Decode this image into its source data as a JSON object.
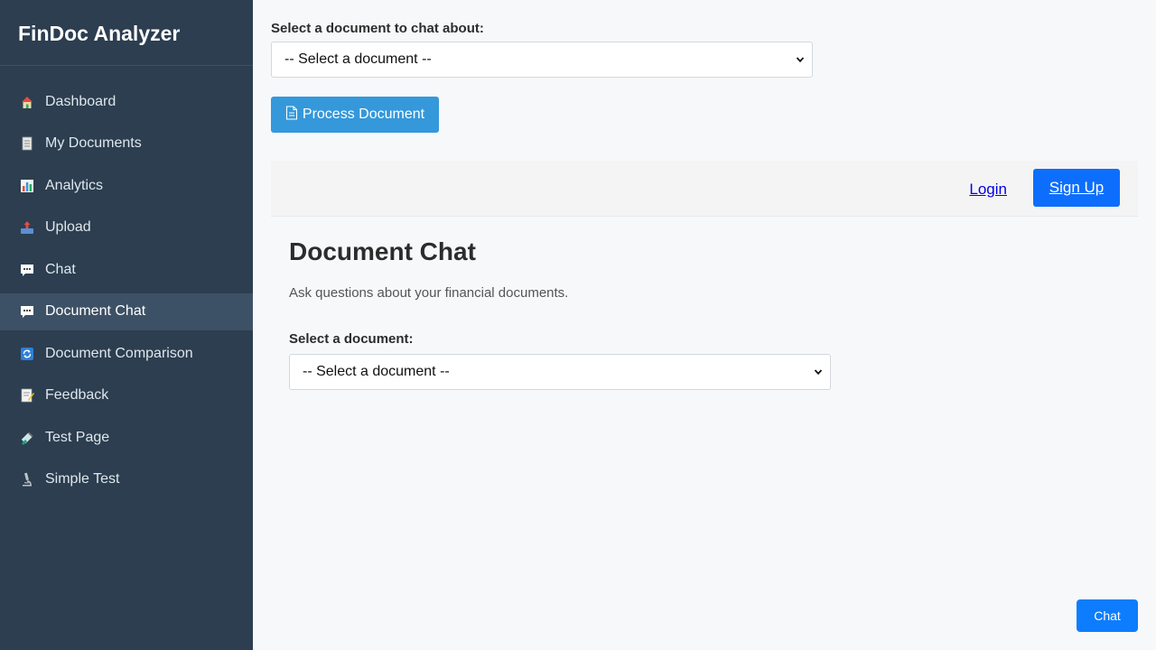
{
  "sidebar": {
    "brand": "FinDoc Analyzer",
    "items": [
      {
        "label": "Dashboard",
        "icon": "house-icon"
      },
      {
        "label": "My Documents",
        "icon": "document-icon"
      },
      {
        "label": "Analytics",
        "icon": "bar-chart-icon"
      },
      {
        "label": "Upload",
        "icon": "upload-tray-icon"
      },
      {
        "label": "Chat",
        "icon": "speech-bubble-icon"
      },
      {
        "label": "Document Chat",
        "icon": "speech-bubble-icon",
        "active": true
      },
      {
        "label": "Document Comparison",
        "icon": "refresh-icon"
      },
      {
        "label": "Feedback",
        "icon": "memo-icon"
      },
      {
        "label": "Test Page",
        "icon": "test-tube-icon"
      },
      {
        "label": "Simple Test",
        "icon": "microscope-icon"
      }
    ]
  },
  "top": {
    "label": "Select a document to chat about:",
    "select_value": "-- Select a document --",
    "process_button": "Process Document"
  },
  "auth": {
    "login": "Login",
    "signup": "Sign Up"
  },
  "content": {
    "title": "Document Chat",
    "subtitle": "Ask questions about your financial documents.",
    "select_label": "Select a document:",
    "select_value": "-- Select a document --"
  },
  "chat_button": "Chat",
  "colors": {
    "sidebar_bg": "#2c3e50",
    "sidebar_active": "#3d5166",
    "process_btn": "#3498db",
    "signup_btn": "#0d6efd",
    "page_bg": "#f7f8fa"
  }
}
